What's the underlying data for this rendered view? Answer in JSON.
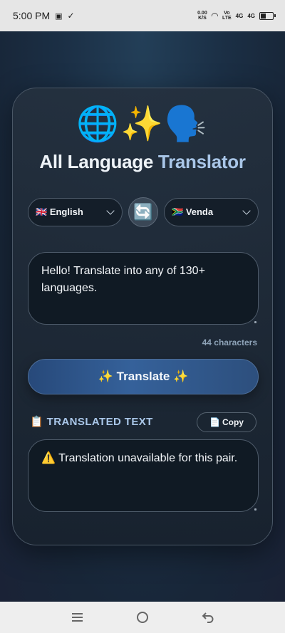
{
  "status_bar": {
    "time": "5:00 PM",
    "net_speed": "0.00",
    "net_unit": "K/S",
    "volte_top": "Vo",
    "volte_bottom": "LTE",
    "sig1": "4G",
    "sig2": "4G"
  },
  "header": {
    "emojis": "🌐✨🗣️",
    "title_part1": "All Language ",
    "title_part2": "Translator"
  },
  "languages": {
    "from_flag": "🇬🇧",
    "from_label": "English",
    "to_flag": "🇿🇦",
    "to_label": "Venda",
    "swap_icon": "🔄"
  },
  "input": {
    "text": "Hello! Translate into any of 130+ languages.",
    "char_count": "44 characters"
  },
  "translate_button": {
    "label": "✨ Translate ✨"
  },
  "output": {
    "section_icon": "📋",
    "section_label": "TRANSLATED TEXT",
    "copy_icon": "📄",
    "copy_label": "Copy",
    "text": "⚠️ Translation unavailable for this pair."
  },
  "colors": {
    "accent": "#a9c6e8",
    "button": "#35619a",
    "background": "#1b2f45"
  },
  "icons": {
    "nav": [
      "menu-icon",
      "home-icon",
      "back-icon"
    ]
  }
}
